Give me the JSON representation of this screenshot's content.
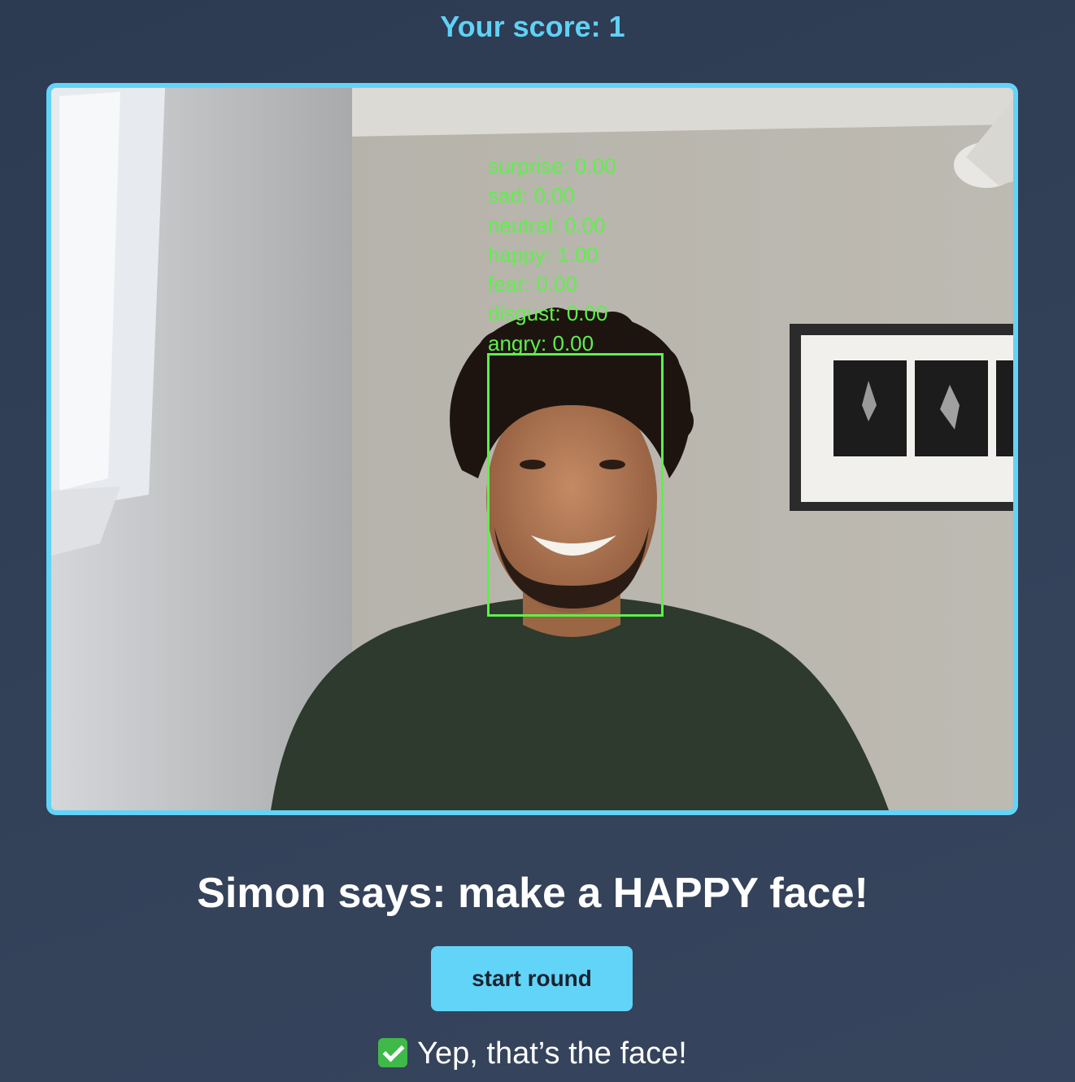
{
  "header": {
    "score_text": "Your score: 1"
  },
  "video": {
    "emotions": [
      {
        "label": "surprise: 0.00"
      },
      {
        "label": "sad: 0.00"
      },
      {
        "label": "neutral: 0.00"
      },
      {
        "label": "happy: 1.00"
      },
      {
        "label": "fear: 0.00"
      },
      {
        "label": "disgust: 0.00"
      },
      {
        "label": "angry: 0.00"
      }
    ]
  },
  "game": {
    "prompt": "Simon says: make a HAPPY face!",
    "start_button_label": "start round",
    "feedback_text": "Yep, that’s the face!",
    "feedback_icon": "check-mark-icon"
  },
  "colors": {
    "accent": "#62d4f7",
    "detection": "#5ef04a",
    "background": "#2f3c54"
  }
}
